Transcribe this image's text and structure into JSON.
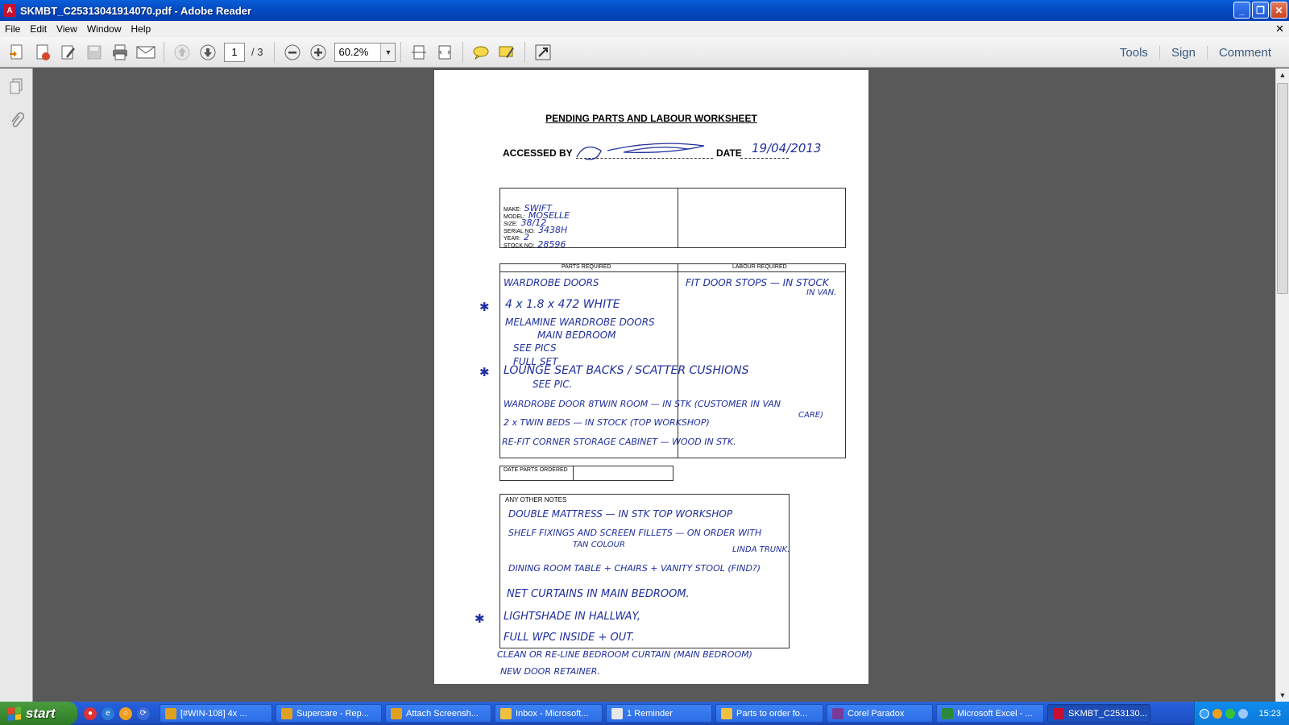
{
  "window": {
    "title": "SKMBT_C25313041914070.pdf - Adobe Reader",
    "controls": [
      "minimize",
      "restore",
      "close"
    ]
  },
  "menu": [
    "File",
    "Edit",
    "View",
    "Window",
    "Help"
  ],
  "toolbar": {
    "page_current": "1",
    "page_total": "/ 3",
    "zoom": "60.2%",
    "panes": [
      "Tools",
      "Sign",
      "Comment"
    ]
  },
  "document": {
    "title": "PENDING PARTS AND LABOUR WORKSHEET",
    "accessed_by_label": "ACCESSED BY",
    "date_label": "DATE",
    "date_value": "19/04/2013",
    "vehicle": [
      {
        "label": "MAKE:",
        "value": "SWIFT"
      },
      {
        "label": "MODEL:",
        "value": "MOSELLE"
      },
      {
        "label": "SIZE:",
        "value": "38/12"
      },
      {
        "label": "SERIAL NO:",
        "value": "3438H"
      },
      {
        "label": "YEAR:",
        "value": "2"
      },
      {
        "label": "STOCK NO:",
        "value": "28596"
      }
    ],
    "parts_header": "PARTS REQUIRED",
    "labour_header": "LABOUR REQUIRED",
    "parts_lines": [
      "WARDROBE DOORS",
      "4 x 1.8 x 472 WHITE",
      "MELAMINE WARDROBE DOORS",
      "MAIN BEDROOM",
      "SEE PICS",
      "FULL SET",
      "LOUNGE SEAT BACKS / SCATTER CUSHIONS",
      "SEE PIC.",
      "WARDROBE DOOR 8TWIN ROOM — IN STK (CUSTOMER IN VAN",
      "CARE)",
      "2 x TWIN BEDS — IN STOCK (TOP WORKSHOP)",
      "RE-FIT CORNER STORAGE CABINET — WOOD IN STK."
    ],
    "labour_lines": [
      "FIT DOOR STOPS — IN STOCK",
      "IN VAN."
    ],
    "date_parts_ordered_label": "DATE PARTS ORDERED",
    "notes_label": "ANY OTHER NOTES",
    "notes_lines": [
      "DOUBLE MATTRESS — IN STK TOP WORKSHOP",
      "SHELF FIXINGS AND SCREEN FILLETS — ON ORDER WITH",
      "TAN COLOUR",
      "LINDA TRUNK.",
      "DINING ROOM TABLE + CHAIRS + VANITY STOOL (FIND?)",
      "NET CURTAINS IN MAIN BEDROOM.",
      "LIGHTSHADE IN HALLWAY,",
      "FULL WPC INSIDE + OUT.",
      "CLEAN OR RE-LINE BEDROOM CURTAIN (MAIN BEDROOM)",
      "NEW DOOR RETAINER."
    ],
    "star_mark": "✱"
  },
  "taskbar": {
    "start_label": "start",
    "tasks": [
      {
        "label": "[#WIN-108] 4x ...",
        "color": "#e0a020"
      },
      {
        "label": "Supercare - Rep...",
        "color": "#e0a020"
      },
      {
        "label": "Attach Screensh...",
        "color": "#e0a020"
      },
      {
        "label": "Inbox - Microsoft...",
        "color": "#f0c040"
      },
      {
        "label": "1 Reminder",
        "color": "#e8e8e8"
      },
      {
        "label": "Parts to order fo...",
        "color": "#f0c040"
      },
      {
        "label": "Corel Paradox",
        "color": "#7a3a9a"
      },
      {
        "label": "Microsoft Excel - ...",
        "color": "#2a8a3a"
      },
      {
        "label": "SKMBT_C253130...",
        "color": "#c8102e"
      }
    ],
    "clock": "15:23"
  }
}
